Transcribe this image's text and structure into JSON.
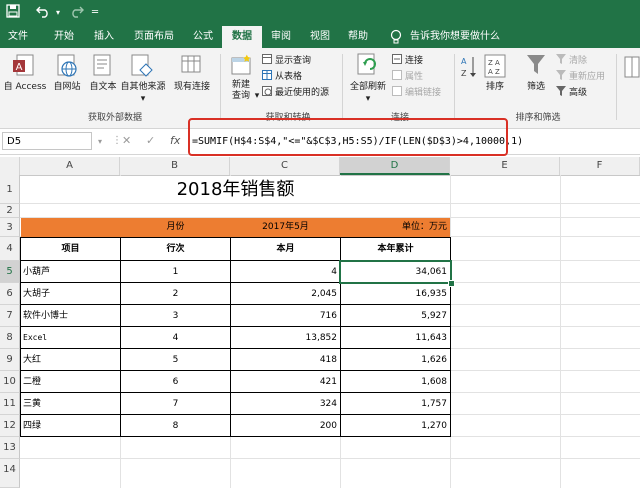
{
  "titlebar": {
    "save_icon": "save-icon",
    "undo_icon": "undo-icon",
    "redo_icon": "redo-icon",
    "customize_icon": "dropdown-icon"
  },
  "tabs": [
    {
      "label": "文件"
    },
    {
      "label": "开始"
    },
    {
      "label": "插入"
    },
    {
      "label": "页面布局"
    },
    {
      "label": "公式"
    },
    {
      "label": "数据",
      "active": true
    },
    {
      "label": "审阅"
    },
    {
      "label": "视图"
    },
    {
      "label": "帮助"
    }
  ],
  "tell_me": "告诉我你想要做什么",
  "ribbon": {
    "get_external": {
      "access": "自 Access",
      "web": "自网站",
      "text": "自文本",
      "other": "自其他来源",
      "existing": "现有连接",
      "group_label": "获取外部数据"
    },
    "transform": {
      "new_query": "新建",
      "new_query_2": "查询",
      "show_query": "显示查询",
      "from_table": "从表格",
      "recent_sources": "最近使用的源",
      "group_label": "获取和转换"
    },
    "connections": {
      "refresh_all": "全部刷新",
      "connections": "连接",
      "properties": "属性",
      "edit_links": "编辑链接",
      "group_label": "连接"
    },
    "sort_filter": {
      "sort": "排序",
      "filter": "筛选",
      "clear": "清除",
      "reapply": "重新应用",
      "advanced": "高级",
      "group_label": "排序和筛选"
    }
  },
  "formula_bar": {
    "name_box": "D5",
    "cancel": "✕",
    "confirm": "✓",
    "fx": "fx",
    "formula": "=SUMIF(H$4:S$4,\"<=\"&$C$3,H5:S5)/IF(LEN($D$3)>4,10000,1)"
  },
  "columns": [
    "A",
    "B",
    "C",
    "D",
    "E",
    "F"
  ],
  "rows": [
    "1",
    "2",
    "3",
    "4",
    "5",
    "6",
    "7",
    "8",
    "9",
    "10",
    "11",
    "12",
    "13",
    "14"
  ],
  "sheet": {
    "title": "2018年销售额",
    "month_label": "月份",
    "month_value": "2017年5月",
    "unit": "单位：万元",
    "headers": [
      "项目",
      "行次",
      "本月",
      "本年累计"
    ],
    "data": [
      {
        "item": "小葫芦",
        "row": "1",
        "month": "4",
        "ytd": "34,061"
      },
      {
        "item": "大胡子",
        "row": "2",
        "month": "2,045",
        "ytd": "16,935"
      },
      {
        "item": "软件小博士",
        "row": "3",
        "month": "716",
        "ytd": "5,927"
      },
      {
        "item": "Excel",
        "row": "4",
        "month": "13,852",
        "ytd": "11,643"
      },
      {
        "item": "大红",
        "row": "5",
        "month": "418",
        "ytd": "1,626"
      },
      {
        "item": "二橙",
        "row": "6",
        "month": "421",
        "ytd": "1,608"
      },
      {
        "item": "三黄",
        "row": "7",
        "month": "324",
        "ytd": "1,757"
      },
      {
        "item": "四绿",
        "row": "8",
        "month": "200",
        "ytd": "1,270"
      }
    ]
  },
  "colors": {
    "excel_green": "#217346",
    "header_orange": "#ed7d31",
    "highlight_red": "#d93025"
  }
}
